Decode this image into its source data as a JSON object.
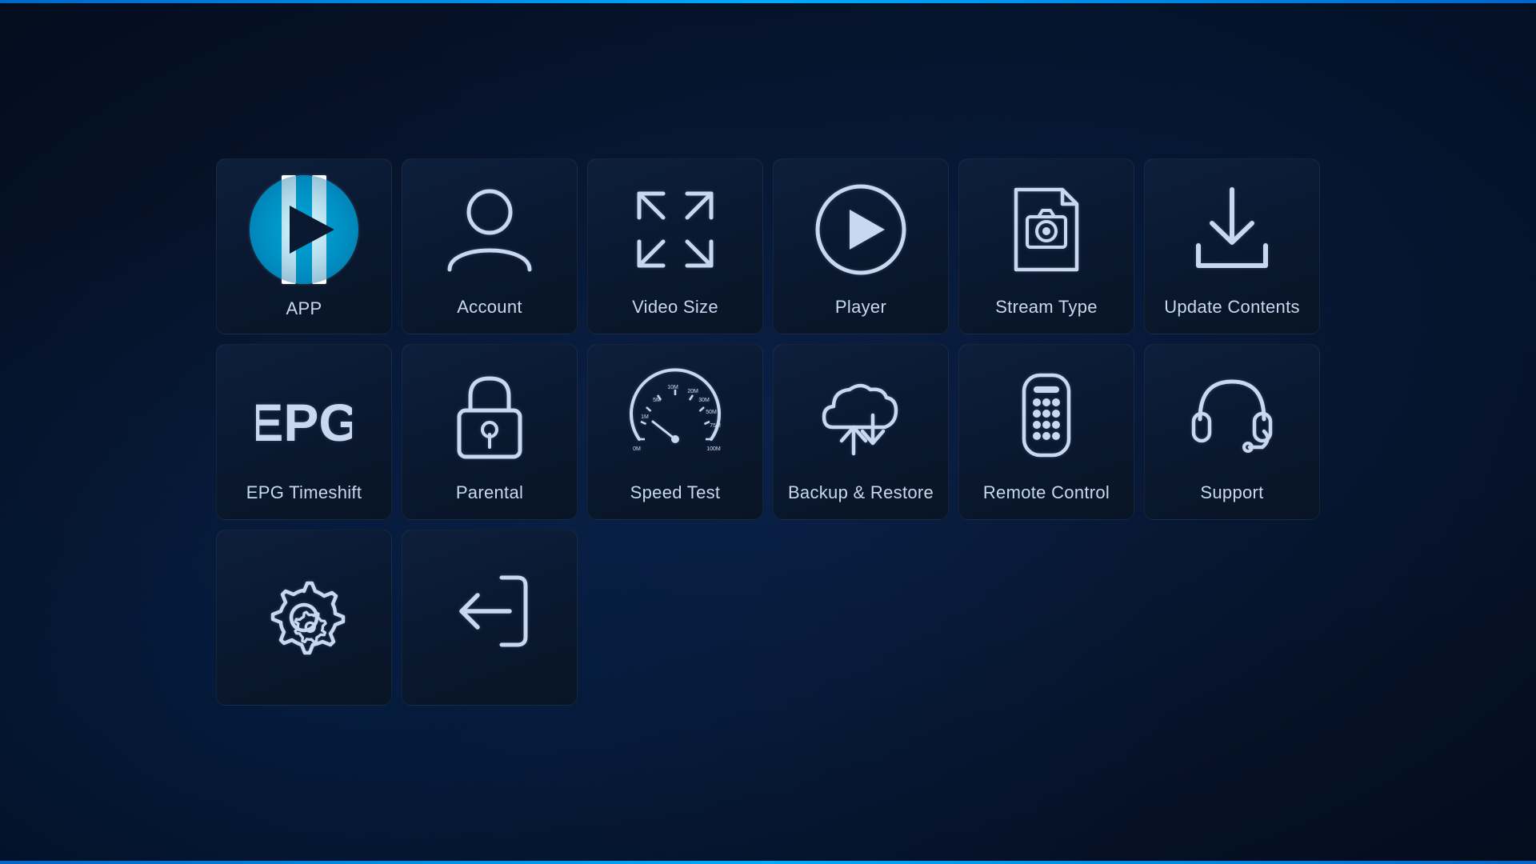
{
  "grid": {
    "items": [
      {
        "id": "app",
        "label": "APP",
        "type": "app-special",
        "row": 1,
        "col": 1
      },
      {
        "id": "account",
        "label": "Account",
        "type": "account",
        "row": 1,
        "col": 2
      },
      {
        "id": "video-size",
        "label": "Video Size",
        "type": "video-size",
        "row": 1,
        "col": 3
      },
      {
        "id": "player",
        "label": "Player",
        "type": "player",
        "row": 1,
        "col": 4
      },
      {
        "id": "stream-type",
        "label": "Stream Type",
        "type": "stream-type",
        "row": 1,
        "col": 5
      },
      {
        "id": "update-contents",
        "label": "Update Contents",
        "type": "update-contents",
        "row": 1,
        "col": 6
      },
      {
        "id": "epg-timeshift",
        "label": "EPG Timeshift",
        "type": "epg",
        "row": 2,
        "col": 1
      },
      {
        "id": "parental",
        "label": "Parental",
        "type": "parental",
        "row": 2,
        "col": 2
      },
      {
        "id": "speed-test",
        "label": "Speed Test",
        "type": "speed-test",
        "row": 2,
        "col": 3
      },
      {
        "id": "backup-restore",
        "label": "Backup & Restore",
        "type": "backup-restore",
        "row": 2,
        "col": 4
      },
      {
        "id": "remote-control",
        "label": "Remote Control",
        "type": "remote-control",
        "row": 2,
        "col": 5
      },
      {
        "id": "support",
        "label": "Support",
        "type": "support",
        "row": 2,
        "col": 6
      },
      {
        "id": "settings",
        "label": "",
        "type": "settings",
        "row": 3,
        "col": 1
      },
      {
        "id": "logout",
        "label": "",
        "type": "logout",
        "row": 3,
        "col": 2
      }
    ]
  }
}
